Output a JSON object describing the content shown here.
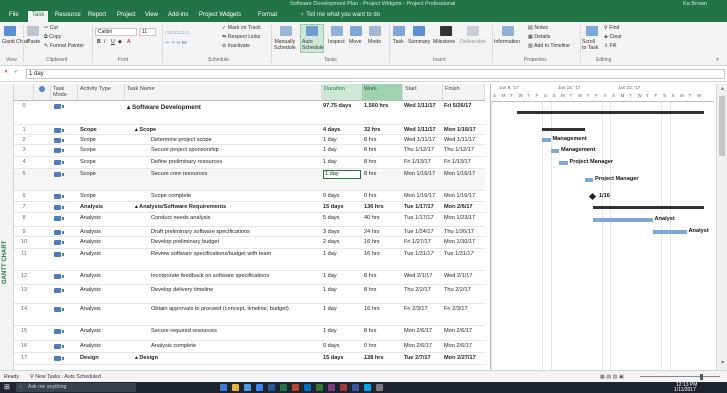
{
  "window": {
    "title": "Software Development Plan - Project Widgets - Project Professional",
    "user": "Ka Brown"
  },
  "tabs": [
    "File",
    "Task",
    "Resource",
    "Report",
    "Project",
    "View",
    "Add-ins",
    "Project Widgets",
    "Format"
  ],
  "tell_me": "Tell me what you want to do",
  "ribbon": {
    "view": {
      "gantt_chart": "Gantt Chart",
      "group": "View"
    },
    "clipboard": {
      "paste": "Paste",
      "cut": "Cut",
      "copy": "Copy",
      "format_painter": "Format Painter",
      "group": "Clipboard"
    },
    "font": {
      "font_name": "Calibri",
      "font_size": "11",
      "bold": "B",
      "italic": "I",
      "underline": "U",
      "group": "Font"
    },
    "schedule": {
      "mark_on_track": "Mark on Track",
      "respect_links": "Respect Links",
      "inactivate": "Inactivate",
      "group": "Schedule"
    },
    "tasks": {
      "manually_schedule": "Manually Schedule",
      "auto_schedule": "Auto Schedule",
      "inspect": "Inspect",
      "move": "Move",
      "mode": "Mode",
      "group": "Tasks"
    },
    "insert": {
      "task": "Task",
      "summary": "Summary",
      "milestone": "Milestone",
      "deliverable": "Deliverable",
      "group": "Insert"
    },
    "properties": {
      "information": "Information",
      "notes": "Notes",
      "details": "Details",
      "add_to_timeline": "Add to Timeline",
      "group": "Properties"
    },
    "editing": {
      "scroll_to_task": "Scroll to Task",
      "find": "Find",
      "clear": "Clear",
      "fill": "Fill",
      "group": "Editing"
    }
  },
  "entry_bar": {
    "value": "1 day"
  },
  "view_label": "GANTT CHART",
  "columns": {
    "info": "i",
    "task_mode": "Task Mode",
    "activity_type": "Activity Type",
    "task_name": "Task Name",
    "duration": "Duration",
    "work": "Work",
    "start": "Start",
    "finish": "Finish"
  },
  "rows": [
    {
      "id": "0",
      "activity": "",
      "name": "Software Development",
      "duration": "97.75 days",
      "work": "1,560 hrs",
      "start": "Wed 1/11/17",
      "finish": "Fri 5/26/17",
      "bold": true,
      "indent": 0
    },
    {
      "id": "1",
      "activity": "Scope",
      "name": "Scope",
      "duration": "4 days",
      "work": "32 hrs",
      "start": "Wed 1/11/17",
      "finish": "Mon 1/16/17",
      "bold": true,
      "indent": 1
    },
    {
      "id": "2",
      "activity": "Scope",
      "name": "Determine project scope",
      "duration": "1 day",
      "work": "8 hrs",
      "start": "Wed 1/11/17",
      "finish": "Wed 1/11/17",
      "bold": false,
      "indent": 2
    },
    {
      "id": "3",
      "activity": "Scope",
      "name": "Secure project sponsorship",
      "duration": "1 day",
      "work": "8 hrs",
      "start": "Thu 1/12/17",
      "finish": "Thu 1/12/17",
      "bold": false,
      "indent": 2
    },
    {
      "id": "4",
      "activity": "Scope",
      "name": "Define preliminary resources",
      "duration": "1 day",
      "work": "8 hrs",
      "start": "Fri 1/13/17",
      "finish": "Fri 1/13/17",
      "bold": false,
      "indent": 2
    },
    {
      "id": "5",
      "activity": "Scope",
      "name": "Secure core resources",
      "duration": "1 day",
      "work": "8 hrs",
      "start": "Mon 1/16/17",
      "finish": "Mon 1/16/17",
      "bold": false,
      "indent": 2
    },
    {
      "id": "6",
      "activity": "Scope",
      "name": "Scope complete",
      "duration": "0 days",
      "work": "0 hrs",
      "start": "Mon 1/16/17",
      "finish": "Mon 1/16/17",
      "bold": false,
      "indent": 2
    },
    {
      "id": "7",
      "activity": "Analysis",
      "name": "Analysis/Software Requirements",
      "duration": "15 days",
      "work": "136 hrs",
      "start": "Tue 1/17/17",
      "finish": "Mon 2/6/17",
      "bold": true,
      "indent": 1
    },
    {
      "id": "8",
      "activity": "Analysis",
      "name": "Conduct needs analysis",
      "duration": "5 days",
      "work": "40 hrs",
      "start": "Tue 1/17/17",
      "finish": "Mon 1/23/17",
      "bold": false,
      "indent": 2
    },
    {
      "id": "9",
      "activity": "Analysis",
      "name": "Draft preliminary software specifications",
      "duration": "3 days",
      "work": "24 hrs",
      "start": "Tue 1/24/17",
      "finish": "Thu 1/26/17",
      "bold": false,
      "indent": 2
    },
    {
      "id": "10",
      "activity": "Analysis",
      "name": "Develop preliminary budget",
      "duration": "2 days",
      "work": "16 hrs",
      "start": "Fri 1/27/17",
      "finish": "Mon 1/30/17",
      "bold": false,
      "indent": 2
    },
    {
      "id": "11",
      "activity": "Analysis",
      "name": "Review software specifications/budget with team",
      "duration": "1 day",
      "work": "16 hrs",
      "start": "Tue 1/31/17",
      "finish": "Tue 1/31/17",
      "bold": false,
      "indent": 2
    },
    {
      "id": "12",
      "activity": "Analysis",
      "name": "Incorporate feedback on software specifications",
      "duration": "1 day",
      "work": "8 hrs",
      "start": "Wed 2/1/17",
      "finish": "Wed 2/1/17",
      "bold": false,
      "indent": 2
    },
    {
      "id": "13",
      "activity": "Analysis",
      "name": "Develop delivery timeline",
      "duration": "1 day",
      "work": "8 hrs",
      "start": "Thu 2/2/17",
      "finish": "Thu 2/2/17",
      "bold": false,
      "indent": 2
    },
    {
      "id": "14",
      "activity": "Analysis",
      "name": "Obtain approvals to proceed (concept, timeline, budget)",
      "duration": "1 day",
      "work": "16 hrs",
      "start": "Fri 2/3/17",
      "finish": "Fri 2/3/17",
      "bold": false,
      "indent": 2
    },
    {
      "id": "15",
      "activity": "Analysis",
      "name": "Secure required resources",
      "duration": "1 day",
      "work": "8 hrs",
      "start": "Mon 2/6/17",
      "finish": "Mon 2/6/17",
      "bold": false,
      "indent": 2
    },
    {
      "id": "16",
      "activity": "Analysis",
      "name": "Analysis complete",
      "duration": "0 days",
      "work": "0 hrs",
      "start": "Mon 2/6/17",
      "finish": "Mon 2/6/17",
      "bold": false,
      "indent": 2
    },
    {
      "id": "17",
      "activity": "Design",
      "name": "Design",
      "duration": "15 days",
      "work": "128 hrs",
      "start": "Tue 2/7/17",
      "finish": "Mon 2/27/17",
      "bold": true,
      "indent": 1
    }
  ],
  "timescale": {
    "weeks": [
      "Jan 8, '17",
      "Jan 15, '17",
      "Jan 22, '17"
    ],
    "days": [
      "S",
      "M",
      "T",
      "W",
      "T",
      "F",
      "S",
      "S",
      "M",
      "T",
      "W",
      "T",
      "F",
      "S",
      "S",
      "M",
      "T",
      "W",
      "T",
      "F",
      "S",
      "S",
      "M",
      "T",
      "W"
    ]
  },
  "gantt_labels": {
    "r2": "Management",
    "r3": "Management",
    "r4": "Project Manager",
    "r5": "Project Manager",
    "r6": "1/16",
    "r8": "Analyst",
    "r9": "Analyst"
  },
  "status": {
    "ready": "Ready",
    "new_tasks": "New Tasks : Auto Scheduled"
  },
  "taskbar": {
    "search": "Ask me anything",
    "clock": "12:13 PM",
    "date": "1/11/2017"
  },
  "colors": {
    "accent": "#227447",
    "bar": "#7ea6d9",
    "summary": "#333333"
  }
}
